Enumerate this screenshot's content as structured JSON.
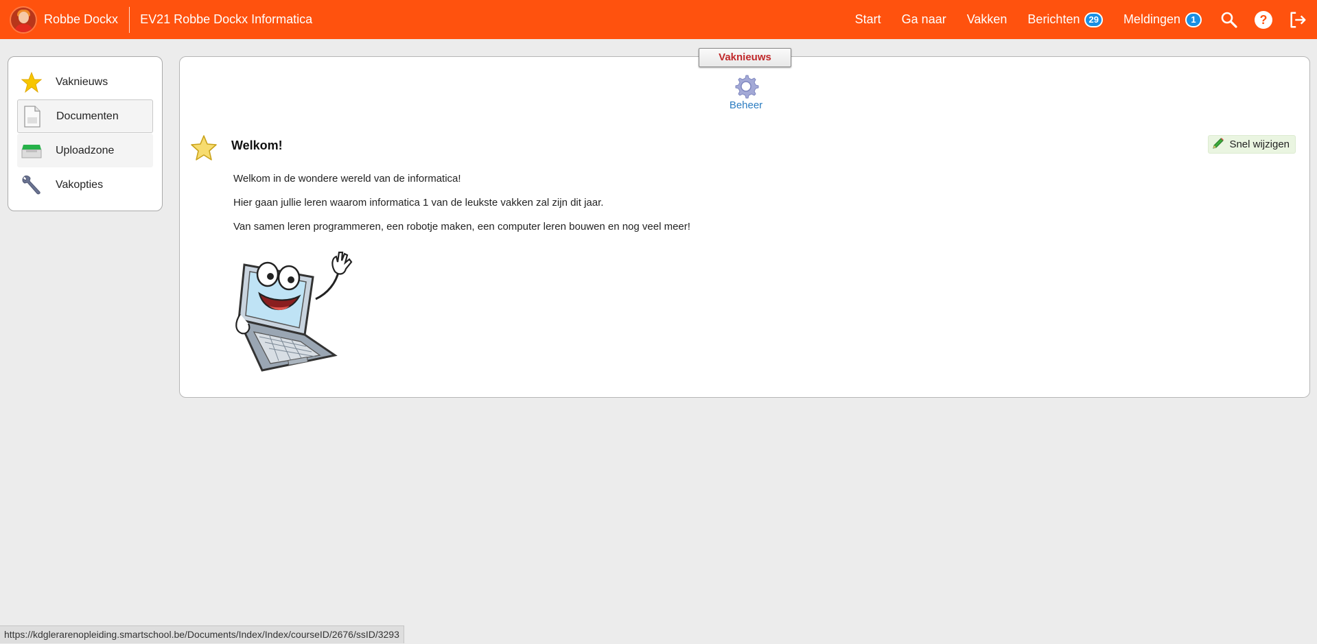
{
  "header": {
    "user_name": "Robbe Dockx",
    "course_name": "EV21 Robbe Dockx Informatica",
    "nav": {
      "start": "Start",
      "ga_naar": "Ga naar",
      "vakken": "Vakken",
      "berichten": "Berichten",
      "berichten_count": "29",
      "meldingen": "Meldingen",
      "meldingen_count": "1"
    },
    "icons": [
      "search-icon",
      "help-icon",
      "logout-icon"
    ],
    "bar_color": "#ff520e"
  },
  "sidebar": {
    "items": [
      {
        "label": "Vaknieuws",
        "icon": "star-icon"
      },
      {
        "label": "Documenten",
        "icon": "document-icon"
      },
      {
        "label": "Uploadzone",
        "icon": "upload-tray-icon"
      },
      {
        "label": "Vakopties",
        "icon": "wrench-icon"
      }
    ]
  },
  "main": {
    "tab_label": "Vaknieuws",
    "beheer_label": "Beheer",
    "news": {
      "title": "Welkom!",
      "quick_edit_label": "Snel wijzigen",
      "paragraphs": [
        "Welkom in de wondere wereld van de informatica!",
        "Hier gaan jullie leren waarom informatica 1 van de leukste vakken zal zijn dit jaar.",
        "Van samen leren programmeren, een robotje maken, een computer leren bouwen en nog veel meer!"
      ]
    }
  },
  "statusbar": {
    "url": "https://kdglerarenopleiding.smartschool.be/Documents/Index/Index/courseID/2676/ssID/3293"
  }
}
